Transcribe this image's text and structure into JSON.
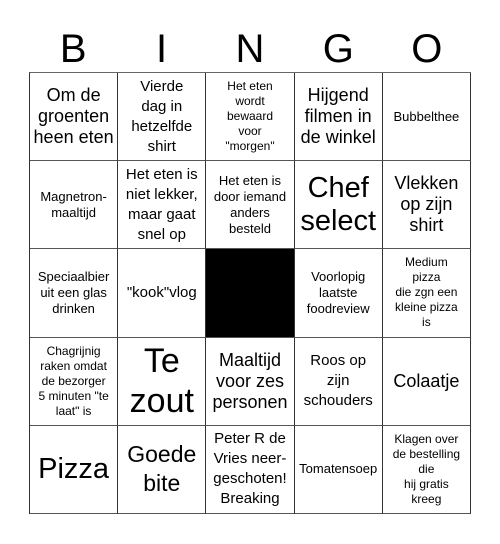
{
  "header": {
    "letters": [
      "B",
      "I",
      "N",
      "G",
      "O"
    ]
  },
  "cells": [
    [
      {
        "text": "Om de\ngroenten\nheen eten",
        "size": "lg"
      },
      {
        "text": "Vierde\ndag in\nhetzelfde\nshirt",
        "size": "md"
      },
      {
        "text": "Het eten\nwordt\nbewaard\nvoor\n\"morgen\"",
        "size": "xs"
      },
      {
        "text": "Hijgend\nfilmen in\nde winkel",
        "size": "lg"
      },
      {
        "text": "Bubbelthee",
        "size": "sm"
      }
    ],
    [
      {
        "text": "Magnetron-\nmaaltijd",
        "size": "sm"
      },
      {
        "text": "Het eten is\nniet lekker,\nmaar gaat\nsnel op",
        "size": "md"
      },
      {
        "text": "Het eten is\ndoor iemand\nanders\nbesteld",
        "size": "sm"
      },
      {
        "text": "Chef\nselect",
        "size": "xxl"
      },
      {
        "text": "Vlekken\nop zijn\nshirt",
        "size": "lg"
      }
    ],
    [
      {
        "text": "Speciaalbier\nuit een glas\ndrinken",
        "size": "sm"
      },
      {
        "text": "\"kook\"vlog",
        "size": "md"
      },
      {
        "text": "",
        "free": true
      },
      {
        "text": "Voorlopig\nlaatste\nfoodreview",
        "size": "sm"
      },
      {
        "text": "Medium\npizza\ndie zgn een\nkleine pizza\nis",
        "size": "xs"
      }
    ],
    [
      {
        "text": "Chagrijnig\nraken omdat\nde bezorger\n5 minuten \"te\nlaat\" is",
        "size": "xs"
      },
      {
        "text": "Te\nzout",
        "size": "xxxl"
      },
      {
        "text": "Maaltijd\nvoor zes\npersonen",
        "size": "lg"
      },
      {
        "text": "Roos op\nzijn\nschouders",
        "size": "md"
      },
      {
        "text": "Colaatje",
        "size": "lg"
      }
    ],
    [
      {
        "text": "Pizza",
        "size": "xxl"
      },
      {
        "text": "Goede\nbite",
        "size": "xl"
      },
      {
        "text": "Peter R de\nVries neer-\ngeschoten!\nBreaking",
        "size": "md"
      },
      {
        "text": "Tomatensoep",
        "size": "sm"
      },
      {
        "text": "Klagen over\nde bestelling\ndie\nhij gratis\nkreeg",
        "size": "xs"
      }
    ]
  ]
}
